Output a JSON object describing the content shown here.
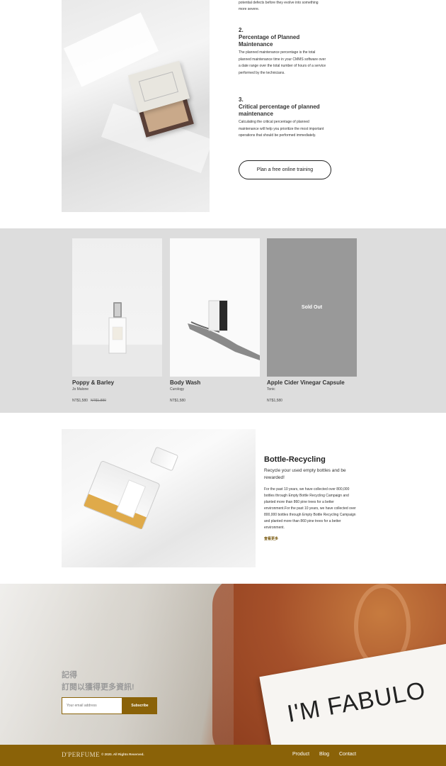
{
  "maintenance": {
    "intro_tail": "potential defects before they evolve into something more severe.",
    "steps": [
      {
        "num": "2.",
        "title": "Percentage of Planned Maintenance",
        "desc": "The planned maintenance percentage is the total planned maintenance time in your CMMS software over a date range over the total number of hours of a service performed by the technicians."
      },
      {
        "num": "3.",
        "title": "Critical percentage of planned maintenance",
        "desc": "Calculating the critical percentage of planned maintenance will help you prioritize the most important operations that should be performed immediately."
      }
    ],
    "button_label": "Plan a free online training"
  },
  "products": [
    {
      "name": "Poppy & Barley",
      "brand": "Jo Malone",
      "price": "NT$1,580",
      "old_price": "NT$1,880",
      "sold_out": ""
    },
    {
      "name": "Body Wash",
      "brand": "Curology",
      "price": "NT$1,580",
      "old_price": "",
      "sold_out": ""
    },
    {
      "name": "Apple Cider Vinegar Capsule",
      "brand": "Tonic",
      "price": "NT$1,580",
      "old_price": "",
      "sold_out": "Sold Out"
    }
  ],
  "recycle": {
    "title": "Bottle-Recycling",
    "subtitle": "Recycle your used empty bottles and be rewarded!",
    "body": "For the past 10 years, we have collected over 800,000 bottles through Empty Bottle Recycling Campaign and planted more than 860 pine trees for a better environment.For the past 10 years, we have collected over 800,000 bottles through Empty Bottle Recycling Campaign and planted more than 860 pine trees for a better environment.",
    "link": "查看更多"
  },
  "subscribe": {
    "title_line1": "記得",
    "title_line2": "訂閱以獲得更多資訊!",
    "placeholder": "Your email address",
    "button": "Subscribe",
    "card_text": "I'M FABULO"
  },
  "footer": {
    "logo": "D'PERFUME",
    "copyright": "© 2020. All Rights Reserved.",
    "nav": [
      "Product",
      "Blog",
      "Contact"
    ]
  },
  "colors": {
    "brand": "#8a6208",
    "section_gray": "#dddddd",
    "sold_out": "#999999"
  }
}
